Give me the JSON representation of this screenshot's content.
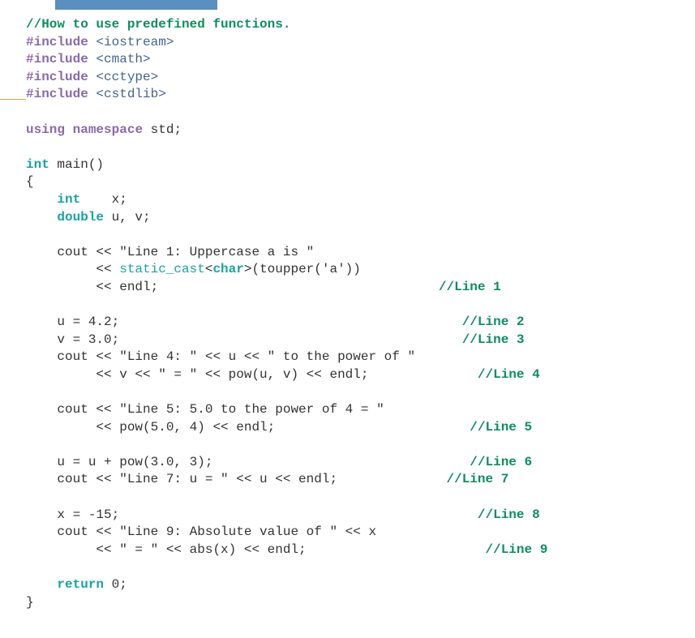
{
  "code": {
    "comment_top": "//How to use predefined functions.",
    "include_kw": "#include",
    "inc1": "<iostream>",
    "inc2": "<cmath>",
    "inc3": "<cctype>",
    "inc4": "<cstdlib>",
    "using_kw": "using",
    "namespace_kw": "namespace",
    "std_txt": " std;",
    "int_kw": "int",
    "main_txt": " main()",
    "brace_open": "{",
    "decl_int_pad": "    ",
    "decl_int_rest": "    x;",
    "double_kw": "double",
    "decl_double_rest": " u, v;",
    "cout1a": "    cout << \"Line 1: Uppercase a is \"",
    "cout1b_pre": "         << ",
    "static_cast_kw": "static_cast",
    "cout1b_mid": "<",
    "char_kw": "char",
    "cout1b_post": ">(toupper('a'))",
    "cout1c": "         << endl;",
    "cmt1": "//Line 1",
    "line_u": "    u = 4.2;",
    "cmt2": "//Line 2",
    "line_v": "    v = 3.0;",
    "cmt3": "//Line 3",
    "cout4a": "    cout << \"Line 4: \" << u << \" to the power of \"",
    "cout4b": "         << v << \" = \" << pow(u, v) << endl;",
    "cmt4": "//Line 4",
    "cout5a": "    cout << \"Line 5: 5.0 to the power of 4 = \"",
    "cout5b": "         << pow(5.0, 4) << endl;",
    "cmt5": "//Line 5",
    "line6": "    u = u + pow(3.0, 3);",
    "cmt6": "//Line 6",
    "cout7": "    cout << \"Line 7: u = \" << u << endl;",
    "cmt7": "//Line 7",
    "line8": "    x = -15;",
    "cmt8": "//Line 8",
    "cout9a": "    cout << \"Line 9: Absolute value of \" << x",
    "cout9b": "         << \" = \" << abs(x) << endl;",
    "cmt9": "//Line 9",
    "return_kw": "return",
    "return_rest": " 0;",
    "brace_close": "}",
    "pad_cmt1": "                                    ",
    "pad_cmt2": "                                            ",
    "pad_cmt3": "                                            ",
    "pad_cmt4": "              ",
    "pad_cmt5": "                         ",
    "pad_cmt6": "                                 ",
    "pad_cmt7": "              ",
    "pad_cmt8": "                                              ",
    "pad_cmt9": "                       "
  }
}
